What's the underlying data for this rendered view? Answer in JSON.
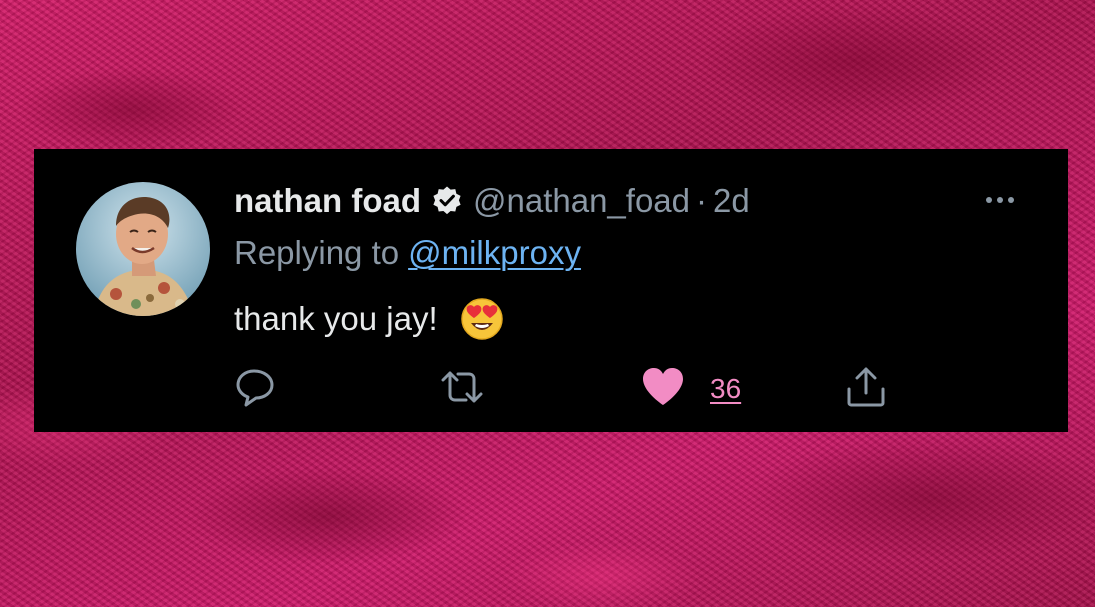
{
  "tweet": {
    "author": {
      "display_name": "nathan foad",
      "handle": "@nathan_foad",
      "verified": true,
      "avatar": "avatar-photo"
    },
    "separator": "·",
    "time_ago": "2d",
    "replying_to_prefix": "Replying to",
    "replying_to_handle": "@milkproxy",
    "text": "thank you jay!",
    "emoji": "smiling-face-with-heart-eyes",
    "actions": {
      "reply_icon": "reply-icon",
      "retweet_icon": "retweet-icon",
      "like_icon": "heart-icon",
      "like_count": "36",
      "share_icon": "share-icon",
      "more_icon": "more-options-icon"
    }
  },
  "colors": {
    "card_background": "#000000",
    "primary_text": "#e7e9ea",
    "secondary_text": "#8b98a5",
    "link": "#6db3f2",
    "like_pink": "#f28cc4",
    "background_fabric": "#c81560"
  }
}
